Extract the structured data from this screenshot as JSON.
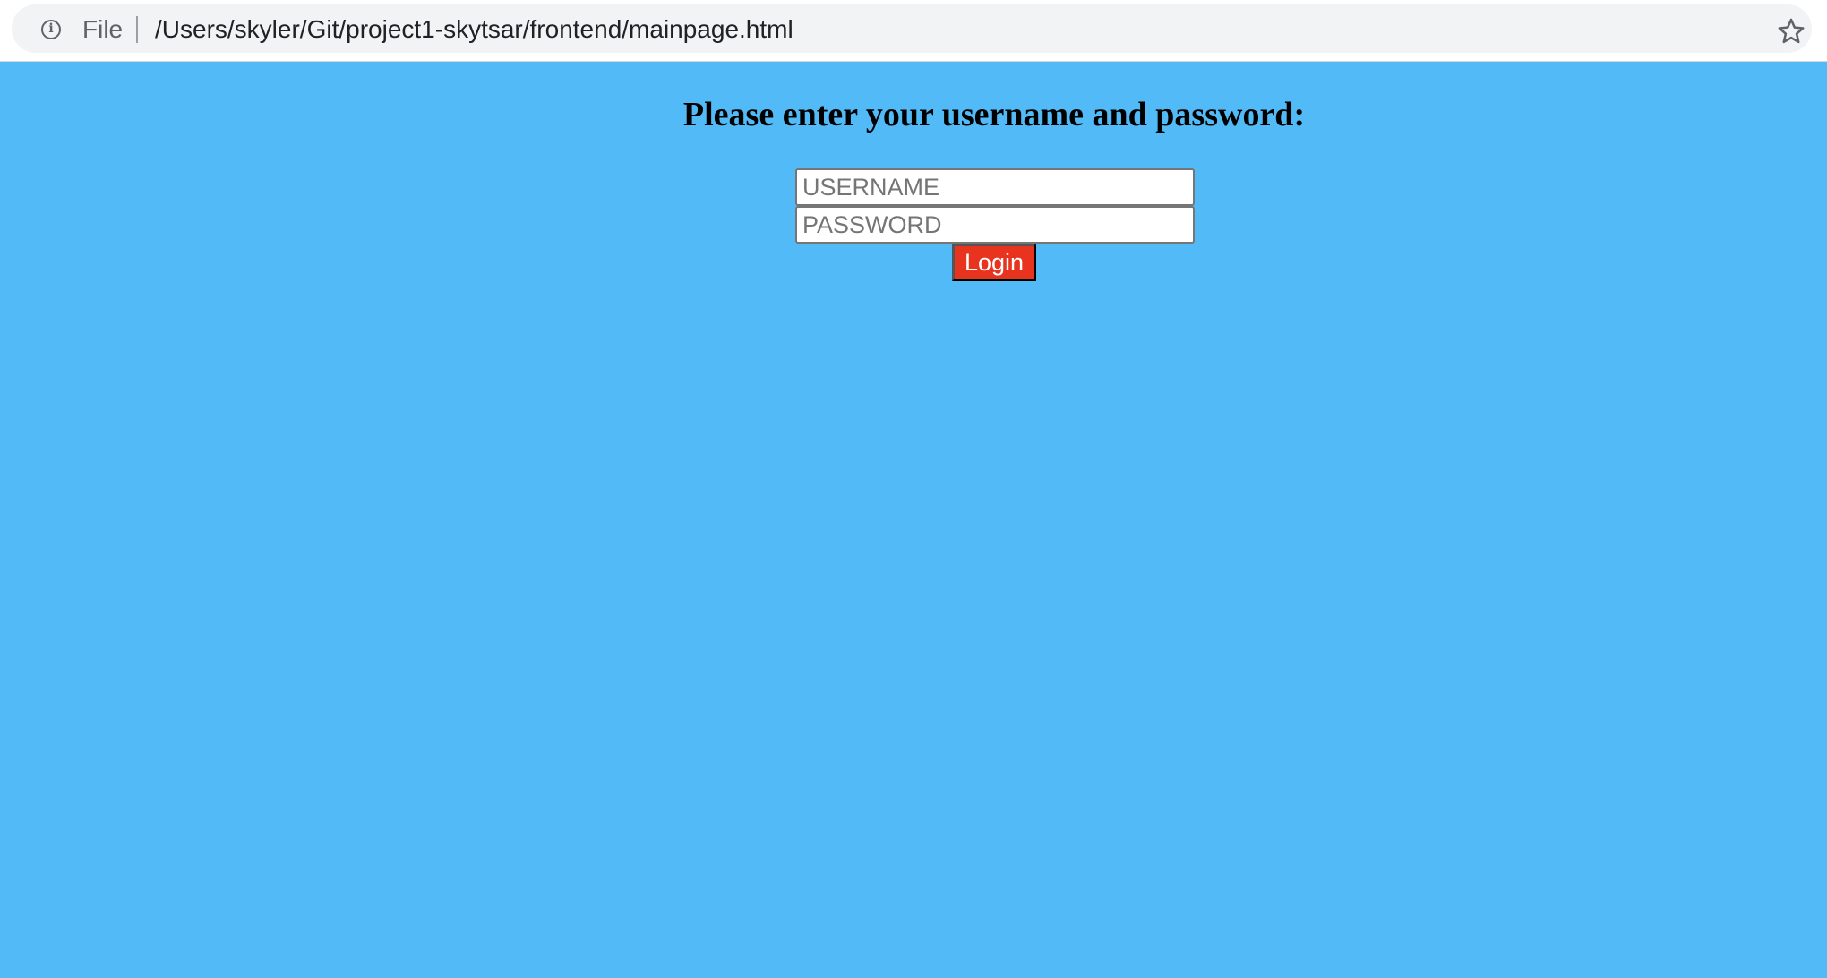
{
  "browser": {
    "file_label": "File",
    "url": "/Users/skyler/Git/project1-skytsar/frontend/mainpage.html",
    "info_icon": "info-icon",
    "bookmark_icon": "star-icon"
  },
  "page": {
    "background_color": "#52bbf7",
    "title": "Please enter your username and password:",
    "username_placeholder": "USERNAME",
    "password_placeholder": "PASSWORD",
    "login_label": "Login",
    "login_color": "#e8331f"
  }
}
